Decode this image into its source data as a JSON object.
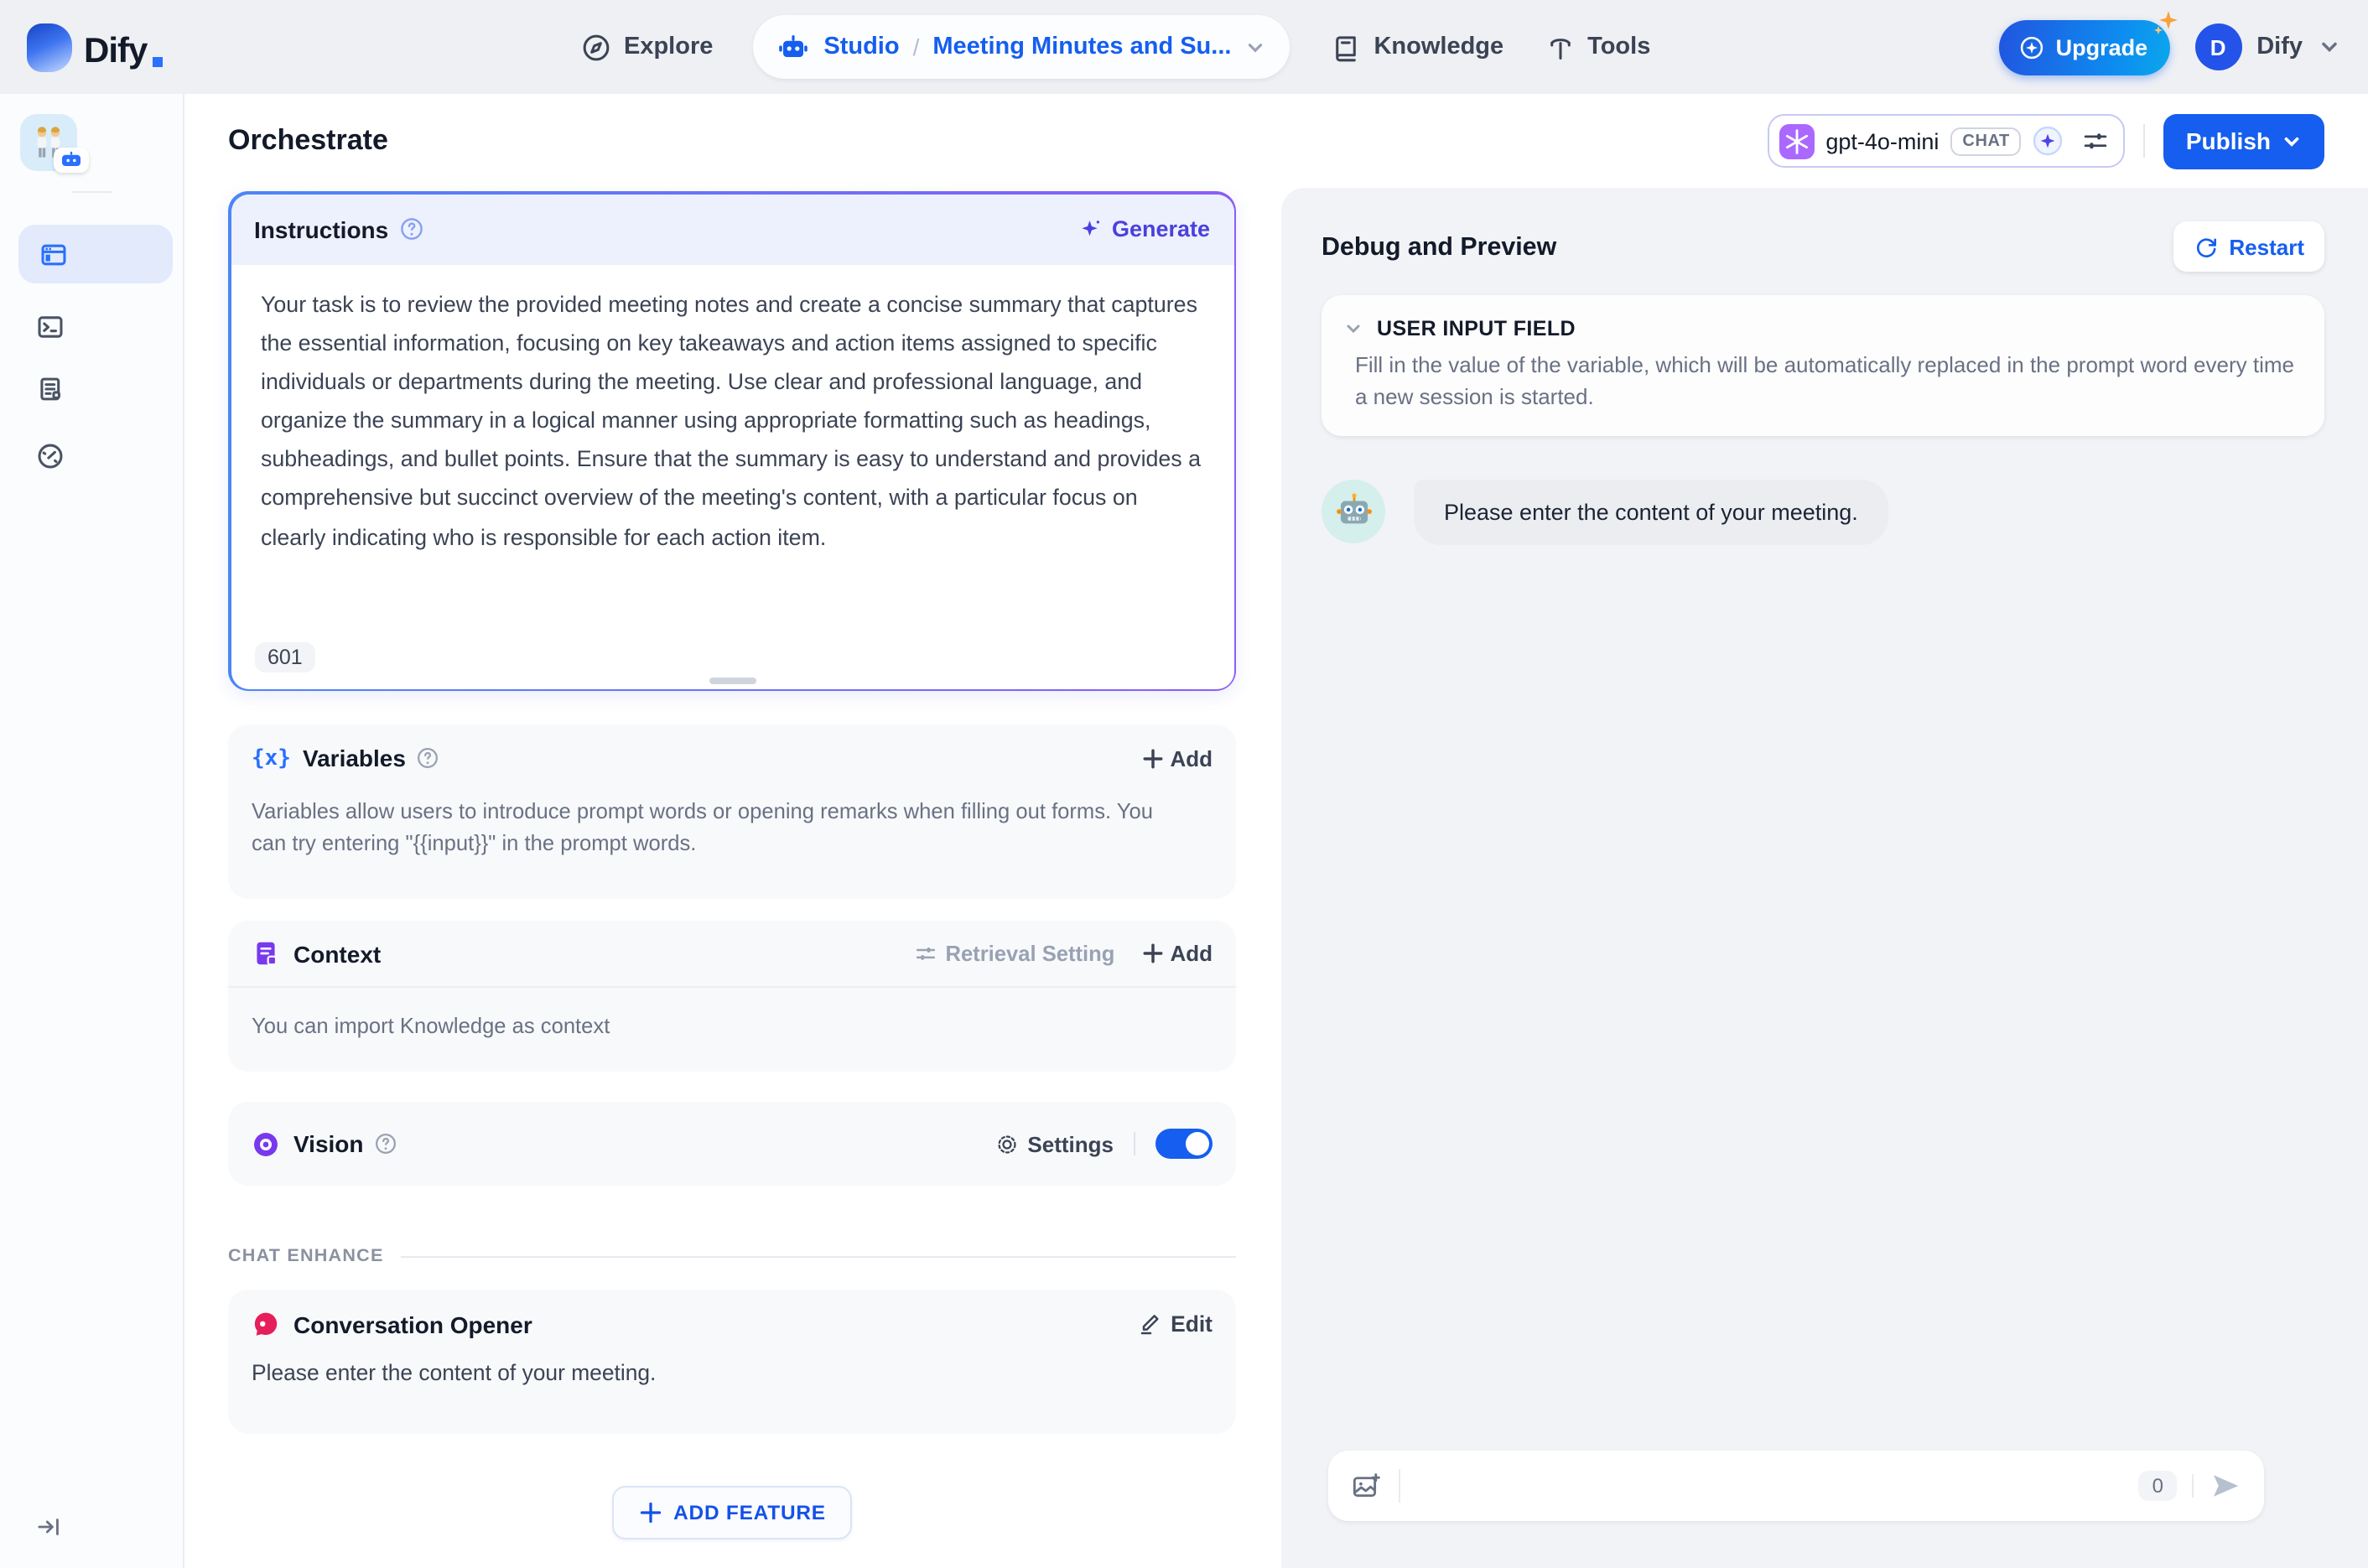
{
  "header": {
    "brand": "Dify",
    "nav": {
      "explore": "Explore",
      "studio": "Studio",
      "app_name": "Meeting Minutes and Su...",
      "knowledge": "Knowledge",
      "tools": "Tools"
    },
    "upgrade_label": "Upgrade",
    "user_initial": "D",
    "user_name": "Dify"
  },
  "subheader": {
    "title": "Orchestrate",
    "model": {
      "name": "gpt-4o-mini",
      "mode_badge": "CHAT"
    },
    "publish_label": "Publish"
  },
  "config": {
    "instructions": {
      "title": "Instructions",
      "generate_label": "Generate",
      "body": "Your task is to review the provided meeting notes and create a concise summary that captures the essential information, focusing on key takeaways and action items assigned to specific individuals or departments during the meeting. Use clear and professional language, and organize the summary in a logical manner using appropriate formatting such as headings, subheadings, and bullet points. Ensure that the summary is easy to understand and provides a comprehensive but succinct overview of the meeting's content, with a particular focus on clearly indicating who is responsible for each action item.",
      "char_count": "601"
    },
    "variables": {
      "icon_glyph": "{x}",
      "title": "Variables",
      "add_label": "Add",
      "description": "Variables allow users to introduce prompt words or opening remarks when filling out forms. You can try entering \"{{input}}\" in the prompt words."
    },
    "context": {
      "title": "Context",
      "retrieval_setting_label": "Retrieval Setting",
      "add_label": "Add",
      "description": "You can import Knowledge as context"
    },
    "vision": {
      "title": "Vision",
      "settings_label": "Settings",
      "enabled": true
    },
    "chat_enhance_label": "CHAT ENHANCE",
    "conversation_opener": {
      "title": "Conversation Opener",
      "edit_label": "Edit",
      "message": "Please enter the content of your meeting."
    },
    "add_feature_label": "ADD FEATURE"
  },
  "debug": {
    "title": "Debug and Preview",
    "restart_label": "Restart",
    "user_input_field": {
      "title": "USER INPUT FIELD",
      "description": "Fill in the value of the variable, which will be automatically replaced in the prompt word every time a new session is started."
    },
    "bot_message": "Please enter the content of your meeting.",
    "input": {
      "counter": "0"
    }
  },
  "colors": {
    "accent_blue": "#155eef",
    "indigo": "#4b40dd",
    "purple": "#7839ee",
    "pink": "#e61e5b",
    "openai_purple": "#ab68ff"
  }
}
